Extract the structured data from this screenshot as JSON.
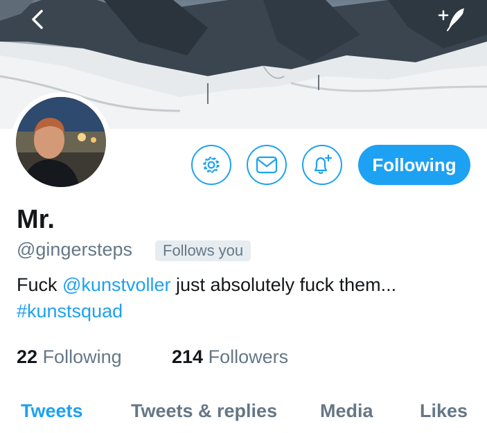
{
  "colors": {
    "accent": "#1da1f2",
    "text_primary": "#14171a",
    "text_secondary": "#657786",
    "badge_background": "#e6ecf0"
  },
  "header": {
    "back_icon": "chevron-left-icon",
    "compose_icon": "compose-tweet-icon"
  },
  "actions": {
    "settings_icon": "gear-icon",
    "message_icon": "envelope-icon",
    "notify_icon": "bell-plus-icon",
    "following_label": "Following"
  },
  "profile": {
    "display_name": "Mr.",
    "handle": "@gingersteps",
    "follows_you": "Follows you",
    "bio": {
      "before_mention": "Fuck ",
      "mention": "@kunstvoller",
      "after_mention": " just absolutely fuck them...",
      "hashtag": "#kunstsquad"
    }
  },
  "stats": {
    "following_count": "22",
    "following_label": "Following",
    "followers_count": "214",
    "followers_label": "Followers"
  },
  "tabs": [
    {
      "label": "Tweets",
      "active": true
    },
    {
      "label": "Tweets & replies",
      "active": false
    },
    {
      "label": "Media",
      "active": false
    },
    {
      "label": "Likes",
      "active": false
    }
  ]
}
